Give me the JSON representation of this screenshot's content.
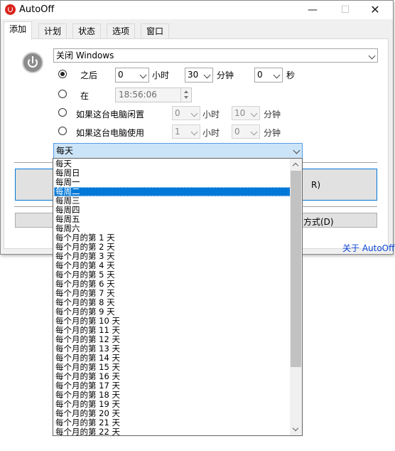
{
  "window": {
    "title": "AutoOff",
    "min_glyph": "—",
    "max_glyph": "☐",
    "close_glyph": "✕"
  },
  "tabs": [
    {
      "label": "添加"
    },
    {
      "label": "计划"
    },
    {
      "label": "状态"
    },
    {
      "label": "选项"
    },
    {
      "label": "窗口"
    }
  ],
  "action": {
    "selected": "关闭 Windows"
  },
  "rows": {
    "after": {
      "label": "之后",
      "hours_value": "0",
      "hours_unit": "小时",
      "minutes_value": "30",
      "minutes_unit": "分钟",
      "seconds_value": "0",
      "seconds_unit": "秒"
    },
    "at": {
      "label": "在",
      "time_value": "18:56:06"
    },
    "idle": {
      "label": "如果这台电脑闲置",
      "hours_value": "0",
      "hours_unit": "小时",
      "minutes_value": "10",
      "minutes_unit": "分钟"
    },
    "used": {
      "label": "如果这台电脑使用",
      "hours_value": "1",
      "hours_unit": "小时",
      "minutes_value": "0",
      "minutes_unit": "分钟"
    }
  },
  "frequency": {
    "selected": "每天",
    "highlighted_index": 3,
    "options": [
      "每天",
      "每周日",
      "每周一",
      "每周二",
      "每周三",
      "每周四",
      "每周五",
      "每周六",
      "每个月的第 1 天",
      "每个月的第 2 天",
      "每个月的第 3 天",
      "每个月的第 4 天",
      "每个月的第 5 天",
      "每个月的第 6 天",
      "每个月的第 7 天",
      "每个月的第 8 天",
      "每个月的第 9 天",
      "每个月的第 10 天",
      "每个月的第 11 天",
      "每个月的第 12 天",
      "每个月的第 13 天",
      "每个月的第 14 天",
      "每个月的第 15 天",
      "每个月的第 16 天",
      "每个月的第 17 天",
      "每个月的第 18 天",
      "每个月的第 19 天",
      "每个月的第 20 天",
      "每个月的第 21 天",
      "每个月的第 22 天"
    ]
  },
  "buttons": {
    "add_partial": "R)",
    "method_partial": "方式(D)"
  },
  "footer": {
    "about_link": "关于 AutoOff"
  },
  "colors": {
    "selection": "#0078d7",
    "link": "#0b46d8",
    "combo_focus": "#cce4f7"
  }
}
